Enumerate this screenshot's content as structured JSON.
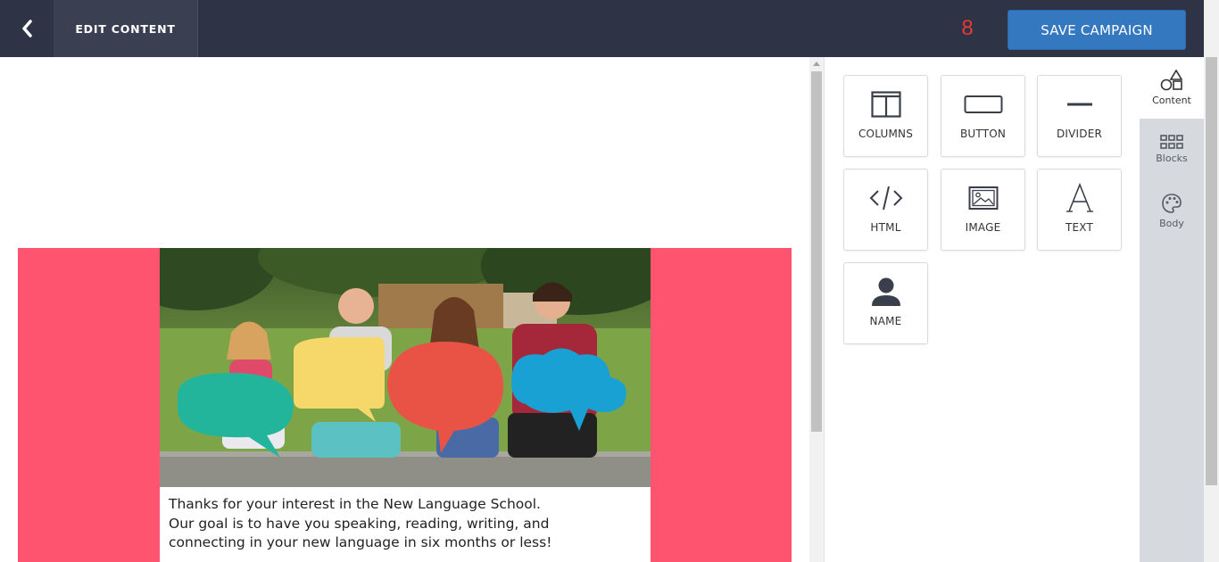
{
  "header": {
    "back_icon": "chevron-left-icon",
    "title": "EDIT CONTENT",
    "counter": "8",
    "save_label": "SAVE CAMPAIGN"
  },
  "email": {
    "body_text_line1": "Thanks for your interest in the New Language School.",
    "body_text_line2": "Our goal is to have you speaking, reading, writing, and",
    "body_text_line3": "connecting in your new language in six months or less!"
  },
  "tools": [
    {
      "label": "COLUMNS",
      "icon": "columns-icon"
    },
    {
      "label": "BUTTON",
      "icon": "button-icon"
    },
    {
      "label": "DIVIDER",
      "icon": "divider-icon"
    },
    {
      "label": "HTML",
      "icon": "code-icon"
    },
    {
      "label": "IMAGE",
      "icon": "image-icon"
    },
    {
      "label": "TEXT",
      "icon": "text-icon"
    },
    {
      "label": "NAME",
      "icon": "user-icon"
    }
  ],
  "side_tabs": [
    {
      "label": "Content",
      "icon": "shapes-icon",
      "active": true
    },
    {
      "label": "Blocks",
      "icon": "grid-icon",
      "active": false
    },
    {
      "label": "Body",
      "icon": "palette-icon",
      "active": false
    }
  ],
  "colors": {
    "topbar": "#2e3346",
    "accent": "#3478c0",
    "email_band": "#ff5470",
    "counter": "#e53935"
  }
}
